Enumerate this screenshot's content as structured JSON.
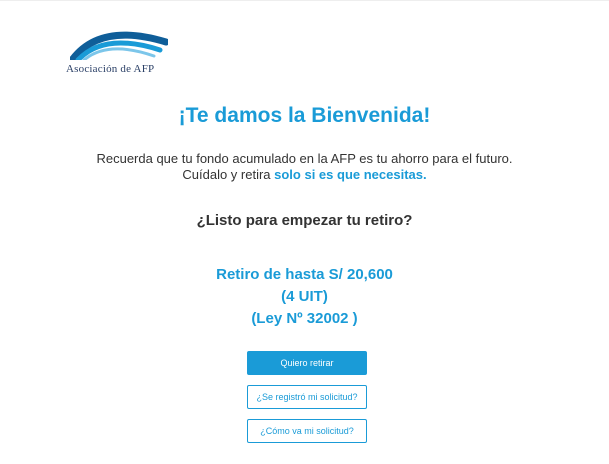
{
  "logo": {
    "text": "Asociación de AFP"
  },
  "welcome": {
    "title": "¡Te damos la Bienvenida!",
    "line1": "Recuerda que tu fondo acumulado en la AFP es tu ahorro para el futuro.",
    "line2_prefix": "Cuídalo y retira ",
    "line2_emphasis": "solo si es que necesitas."
  },
  "question": "¿Listo para empezar tu retiro?",
  "withdrawal": {
    "line1": "Retiro de hasta S/ 20,600",
    "line2": "(4 UIT)",
    "line3": "(Ley Nº 32002 )"
  },
  "buttons": {
    "primary": "Quiero retirar",
    "status": "¿Se registró mi solicitud?",
    "progress": "¿Cómo va mi solicitud?"
  },
  "colors": {
    "accent": "#1a9bd7",
    "logo_navy": "#2a3f66",
    "text": "#333333"
  }
}
